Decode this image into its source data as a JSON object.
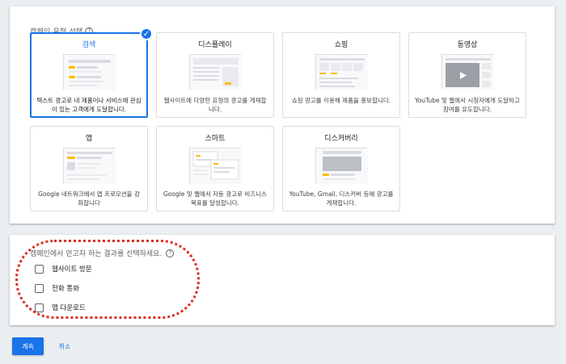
{
  "campaign_type": {
    "title": "캠페인 유형 선택",
    "help_icon": "?",
    "cards": [
      {
        "title": "검색",
        "desc": "텍스트 광고로 내 제품이나 서비스에 관심이 있는 고객에게 도달합니다.",
        "selected": true
      },
      {
        "title": "디스플레이",
        "desc": "웹사이트에 다양한 유형의 광고를 게재합니다."
      },
      {
        "title": "쇼핑",
        "desc": "쇼핑 광고를 이용해 제품을 홍보합니다."
      },
      {
        "title": "동영상",
        "desc": "YouTube 및 웹에서 시청자에게 도달하고 참여를 유도합니다."
      },
      {
        "title": "앱",
        "desc": "Google 네트워크에서 앱 프로모션을 강화합니다"
      },
      {
        "title": "스마트",
        "desc": "Google 및 웹에서 자동 광고로 비즈니스 목표를 달성합니다."
      },
      {
        "title": "디스커버리",
        "desc": "YouTube, Gmail, 디스커버 등에 광고를 게재합니다."
      }
    ],
    "check_icon": "✓"
  },
  "goals": {
    "title": "캠페인에서 얻고자 하는 결과를 선택하세요.",
    "help_icon": "?",
    "items": [
      {
        "label": "웹사이트 방문"
      },
      {
        "label": "전화 통화"
      },
      {
        "label": "앱 다운로드"
      }
    ]
  },
  "actions": {
    "continue_label": "계속",
    "cancel_label": "취소"
  },
  "colors": {
    "accent": "#1a73e8",
    "highlight": "#d93025",
    "thumb_yellow": "#fbbc04"
  }
}
